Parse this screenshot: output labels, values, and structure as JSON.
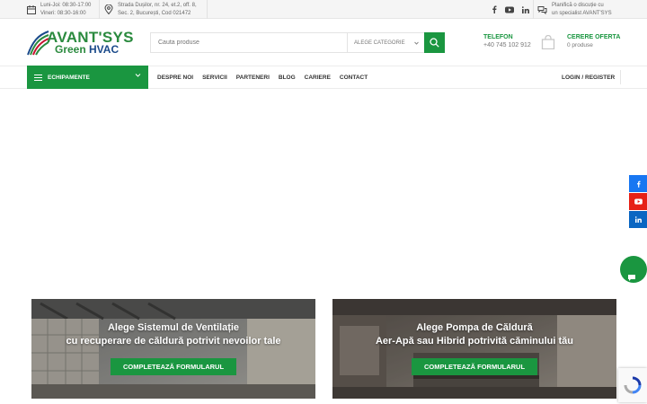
{
  "topbar": {
    "hours": [
      "Luni-Joi: 08:30-17:00",
      "Vineri: 08:30-16:00"
    ],
    "address": [
      "Strada Dușilor, nr. 24, et.2, off. 8,",
      "Sec. 2, București, Cod 021472"
    ],
    "consult": [
      "Planifică o discuție cu",
      "un specialist AVANT'SYS"
    ]
  },
  "logo": {
    "line1": "AVANT'SYS",
    "line2a": "Green ",
    "line2b": "HVAC"
  },
  "search": {
    "placeholder": "Cauta produse",
    "category": "ALEGE CATEGORIE"
  },
  "phone": {
    "label": "TELEFON",
    "value": "+40 745 102 912"
  },
  "quote": {
    "label": "CERERE OFERTA",
    "value": "0 produse"
  },
  "nav": {
    "equipment": "ECHIPAMENTE",
    "items": [
      "DESPRE NOI",
      "SERVICII",
      "PARTENERI",
      "BLOG",
      "CARIERE",
      "CONTACT"
    ],
    "login": "LOGIN / REGISTER"
  },
  "banners": [
    {
      "line1": "Alege Sistemul de Ventilație",
      "line2": "cu recuperare de căldură potrivit nevoilor tale",
      "cta": "COMPLETEAZĂ FORMULARUL"
    },
    {
      "line1": "Alege Pompa de Căldură",
      "line2": "Aer-Apă sau Hibrid potrivită căminului tău",
      "cta": "COMPLETEAZĂ FORMULARUL"
    }
  ],
  "colors": {
    "brand_green": "#1a9640",
    "brand_blue": "#1a4a8a",
    "facebook": "#1877f2",
    "youtube": "#e62117",
    "linkedin": "#0a66c2"
  },
  "icons": [
    "calendar-icon",
    "location-pin-icon",
    "facebook-icon",
    "youtube-icon",
    "linkedin-icon",
    "chat-bubble-icon",
    "search-icon",
    "shopping-bag-icon",
    "hamburger-icon",
    "chevron-down-icon",
    "recaptcha-icon"
  ]
}
